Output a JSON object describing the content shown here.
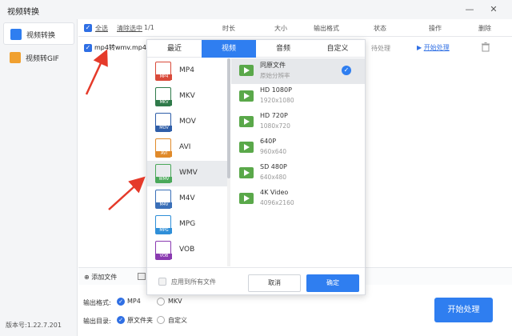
{
  "app": {
    "title": "视频转换",
    "version": "版本号:1.22.7.201"
  },
  "window": {
    "minimize": "—",
    "close": "✕"
  },
  "sidebar": {
    "items": [
      {
        "label": "视频转换",
        "icon": "video-convert-icon",
        "active": true
      },
      {
        "label": "视频转GIF",
        "icon": "gif-icon",
        "active": false
      }
    ]
  },
  "table": {
    "select_all": "全选",
    "clear_selected": "清除选中",
    "count": "1/1",
    "headers": {
      "duration": "时长",
      "size": "大小",
      "output_format": "输出格式",
      "status": "状态",
      "action": "操作",
      "delete": "删除"
    },
    "rows": [
      {
        "name": "mp4转wmv.mp4",
        "status": "待处理",
        "action": "开始处理"
      }
    ]
  },
  "popup": {
    "tabs": [
      "最近",
      "视频",
      "音频",
      "自定义"
    ],
    "active_tab": "视频",
    "formats": [
      {
        "name": "MP4",
        "color": "#d94a3a"
      },
      {
        "name": "MKV",
        "color": "#2f7a4a"
      },
      {
        "name": "MOV",
        "color": "#2f5ea8"
      },
      {
        "name": "AVI",
        "color": "#e08a2a"
      },
      {
        "name": "WMV",
        "color": "#4aa85a"
      },
      {
        "name": "M4V",
        "color": "#3a6fb8"
      },
      {
        "name": "MPG",
        "color": "#2f8fd8"
      },
      {
        "name": "VOB",
        "color": "#8a3ab0"
      }
    ],
    "selected_format": "WMV",
    "resolutions": [
      {
        "name": "同原文件",
        "sub": "原始分辨率",
        "selected": true
      },
      {
        "name": "HD 1080P",
        "sub": "1920x1080",
        "selected": false
      },
      {
        "name": "HD 720P",
        "sub": "1080x720",
        "selected": false
      },
      {
        "name": "640P",
        "sub": "960x640",
        "selected": false
      },
      {
        "name": "SD 480P",
        "sub": "640x480",
        "selected": false
      },
      {
        "name": "4K Video",
        "sub": "4096x2160",
        "selected": false
      }
    ],
    "apply_all": "应用到所有文件",
    "cancel": "取消",
    "ok": "确定"
  },
  "bottom": {
    "add_file": "添加文件",
    "output_format_label": "输出格式:",
    "output_format_options": [
      "MP4",
      "MKV"
    ],
    "output_format_selected": "MP4",
    "output_dir_label": "输出目录:",
    "output_dir_options": [
      "原文件夹",
      "自定义"
    ],
    "output_dir_selected": "原文件夹",
    "start": "开始处理"
  },
  "colors": {
    "accent": "#2f7ef0",
    "arrow": "#e53a2a"
  }
}
